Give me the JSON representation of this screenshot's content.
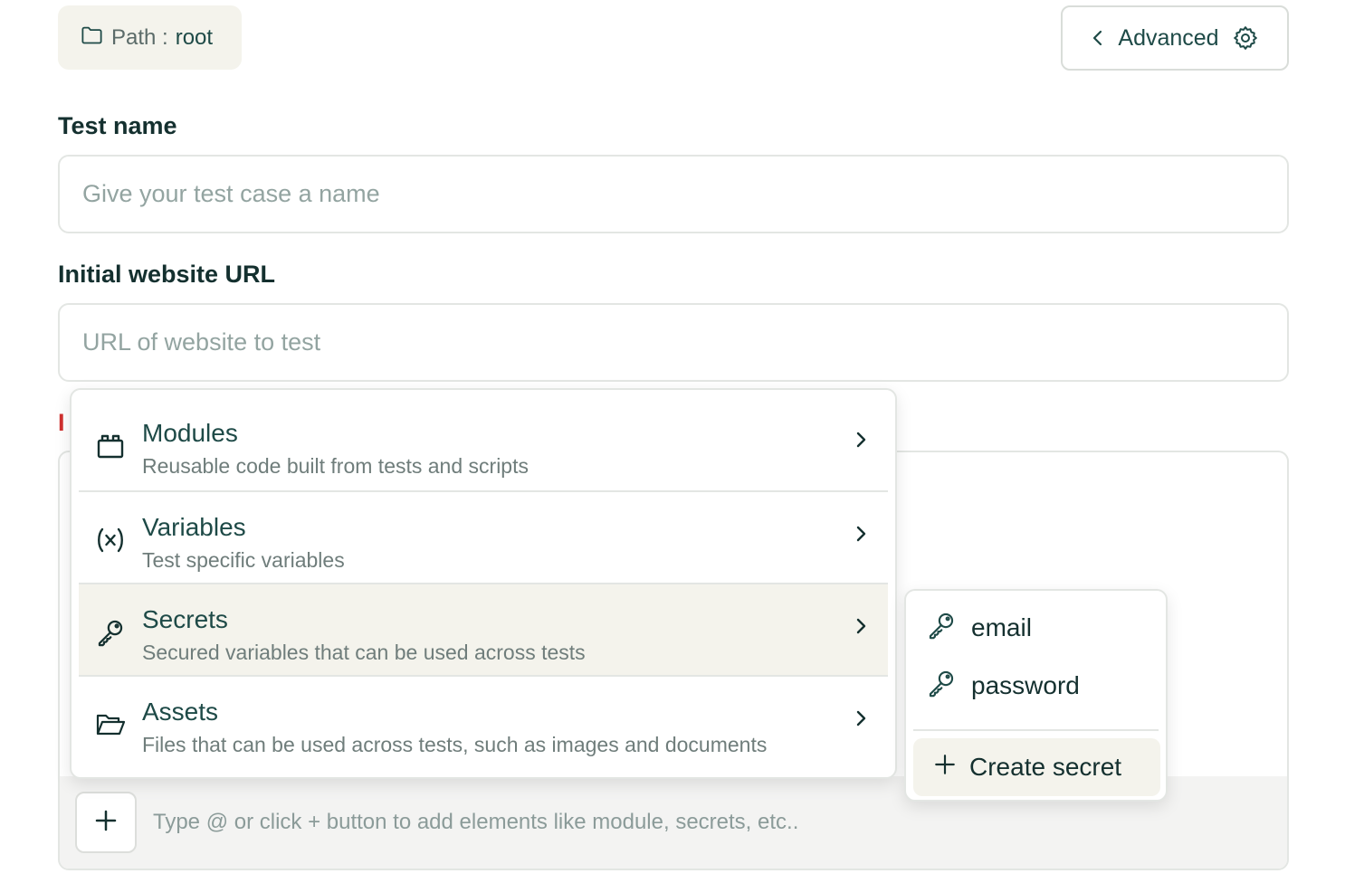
{
  "path_chip": {
    "label": "Path : ",
    "value": "root"
  },
  "advanced_button": {
    "label": "Advanced"
  },
  "form": {
    "test_name": {
      "label": "Test name",
      "value": "",
      "placeholder": "Give your test case a name"
    },
    "website_url": {
      "label": "Initial website URL",
      "value": "",
      "placeholder": "URL of website to test"
    },
    "instructions": {
      "label_visible": "I",
      "hint": "Type @ or click + button to add elements like module, secrets, etc.."
    }
  },
  "insert_menu": {
    "items": [
      {
        "title": "Modules",
        "description": "Reusable code built from tests and scripts",
        "icon": "modules-icon"
      },
      {
        "title": "Variables",
        "description": "Test specific variables",
        "icon": "variable-icon"
      },
      {
        "title": "Secrets",
        "description": "Secured variables that can be used across tests",
        "icon": "key-icon",
        "active": true
      },
      {
        "title": "Assets",
        "description": "Files that can be used across tests, such as images and documents",
        "icon": "folder-open-icon"
      }
    ]
  },
  "secrets_submenu": {
    "items": [
      {
        "label": "email",
        "icon": "key-icon"
      },
      {
        "label": "password",
        "icon": "key-icon"
      }
    ],
    "create_label": "Create secret"
  },
  "colors": {
    "accent_text": "#1e4a47",
    "active_bg": "#f4f3ec",
    "required_red": "#d0302f"
  }
}
